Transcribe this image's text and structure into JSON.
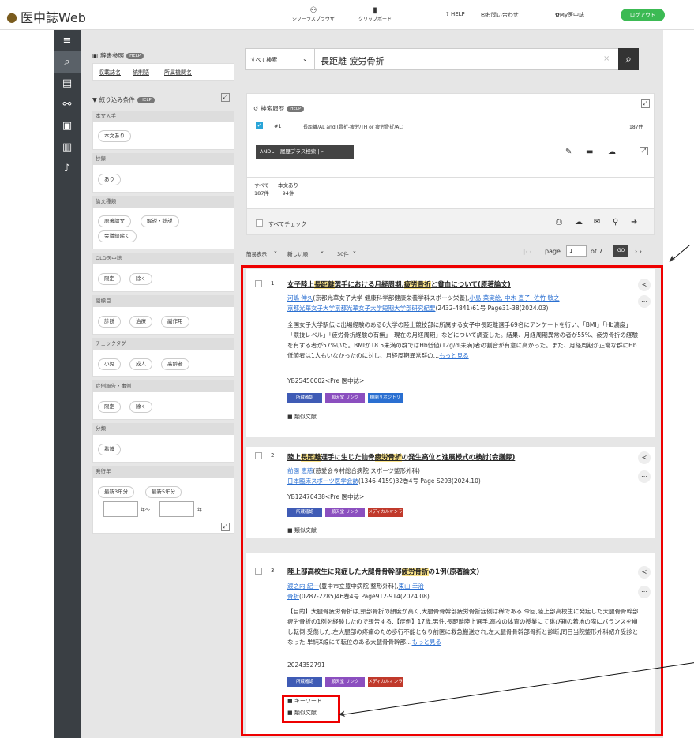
{
  "header": {
    "logo": "医中誌Web",
    "thesaurus": "シソーラスブラウザ",
    "clipboard": "クリップボード",
    "help": "? HELP",
    "contact": "お問い合わせ",
    "my": "My医中誌",
    "logout": "ログアウト"
  },
  "left": {
    "dict": "辞書参照",
    "help": "HELP",
    "links": [
      "収載誌名",
      "統制語",
      "所属機関名"
    ],
    "filter": "絞り込み条件",
    "sections": [
      {
        "h": "本文入手",
        "p": [
          "本文あり"
        ]
      },
      {
        "h": "抄録",
        "p": [
          "あり"
        ]
      },
      {
        "h": "論文種類",
        "p": [
          "原著論文",
          "解説・総説",
          "会議録除く"
        ]
      },
      {
        "h": "OLD医中誌",
        "p": [
          "限定",
          "除く"
        ]
      },
      {
        "h": "副標目",
        "p": [
          "診断",
          "治療",
          "副作用"
        ]
      },
      {
        "h": "チェックタグ",
        "p": [
          "小児",
          "成人",
          "高齢者"
        ]
      },
      {
        "h": "症例報告・事例",
        "p": [
          "限定",
          "除く"
        ]
      },
      {
        "h": "分類",
        "p": [
          "看護"
        ]
      },
      {
        "h": "発行年",
        "p": [
          "最新3年分",
          "最新5年分"
        ]
      }
    ],
    "year_from": "年〜",
    "year_to": "年"
  },
  "search": {
    "scope": "すべて検索",
    "query": "長距離 疲労骨折"
  },
  "history": {
    "title": "検索履歴",
    "row_num": "#1",
    "row_query": "長距離/AL and (骨折-疲労/TH or 疲労骨折/AL)",
    "row_count": "187件",
    "and": "AND",
    "plus": "履歴プラス検索"
  },
  "tabs": [
    {
      "l": "すべて",
      "c": "187件"
    },
    {
      "l": "本文あり",
      "c": "94件"
    }
  ],
  "toolbar": {
    "check_all": "すべてチェック",
    "view": "簡易表示",
    "sort": "新しい順",
    "per": "30件",
    "page": "page",
    "page_num": "1",
    "of": "of 7",
    "go": "GO"
  },
  "results": [
    {
      "n": "1",
      "title_pre": "女子陸上",
      "title_hl": "長距離",
      "title_mid": "選手における月経周期,",
      "title_hl2": "疲労骨折",
      "title_post": "と貧血について(原著論文)",
      "authors": "河嶋 伸久",
      "aff": "(京都光華女子大学 健康科学部健康栄養学科スポーツ栄養),",
      "authors2": "小島 菜実絵, 中木 直子, 佐竹 敏之",
      "journal": "京都光華女子大学京都光華女子大学短期大学部研究紀要",
      "jinfo": "(2432-4841)61号 Page31-38(2024.03)",
      "abstract": "全国女子大学駅伝に出場経験のある6大学の陸上競技部に所属する女子中長距離選手69名にアンケートを行い、「BMI」「Hb濃度」「競技レベル」「疲労骨折経験の有無」「現在の月経周期」などについて調査した。結果、月経周期異常の者が55%、疲労骨折の経験を有する者が57%いた。BMIが18.5未満の群ではHb低値(12g/dl未満)者の割合が有意に高かった。また、月経周期が正常な群にHb低値者は1人もいなかったのに対し、月経周期異常群の…",
      "more": "もっと見る",
      "id": "YB25450002<Pre 医中誌>",
      "tags": [
        "所蔵確認",
        "順天堂 リンク",
        "機関リポジトリ"
      ],
      "links": [
        "類似文献"
      ]
    },
    {
      "n": "2",
      "title_pre": "陸上",
      "title_hl": "長距離",
      "title_mid": "選手に生じた仙骨",
      "title_hl2": "疲労骨折",
      "title_post": "の発生高位と進展様式の検討(会議録)",
      "authors": "前園 恵慈",
      "aff": "(慈愛会今村総合病院 スポーツ整形外科)",
      "authors2": "",
      "journal": "日本臨床スポーツ医学会誌",
      "jinfo": "(1346-4159)32巻4号 Page S293(2024.10)",
      "abstract": "",
      "more": "",
      "id": "YB12470438<Pre 医中誌>",
      "tags": [
        "所蔵確認",
        "順天堂 リンク",
        "メディカルオンライン"
      ],
      "links": [
        "類似文献"
      ]
    },
    {
      "n": "3",
      "title_pre": "陸上部高校生に発症した大腿骨骨幹部",
      "title_hl": "疲労骨折",
      "title_mid": "の1例(原著論文)",
      "title_hl2": "",
      "title_post": "",
      "authors": "渡之内 紀一",
      "aff": "(豊中市立豊中病院 整形外科),",
      "authors2": "東山 幸治",
      "journal": "骨折",
      "jinfo": "(0287-2285)46巻4号 Page912-914(2024.08)",
      "abstract": "【目的】大腿骨疲労骨折は,頸部骨折の頻度が高く,大腿骨骨幹部疲労骨折症例は稀である.今回,陸上部高校生に発症した大腿骨骨幹部疲労骨折の1例を経験したので報告する.【症例】17歳,男性,長距離陸上選手.高校の体育の授業にて跳び箱の着地の際にバランスを崩し転倒,受傷した.左大腿部の疼痛のため歩行不能となり前医に救急搬送され,左大腿骨骨幹部骨折と診断,同日当院整形外科紹介受診となった.単純X線にて転位のある大腿骨骨幹部…",
      "more": "もっと見る",
      "id": "2024352791",
      "tags": [
        "所蔵確認",
        "順天堂 リンク",
        "メディカルオンライン"
      ],
      "links": [
        "キーワード",
        "類似文献"
      ]
    }
  ]
}
